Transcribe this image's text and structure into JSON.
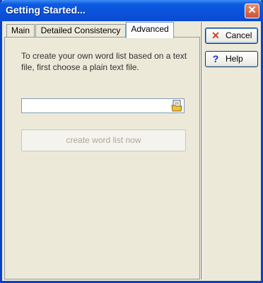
{
  "window": {
    "title": "Getting Started..."
  },
  "tabs": [
    {
      "label": "Main"
    },
    {
      "label": "Detailed Consistency"
    },
    {
      "label": "Advanced"
    }
  ],
  "advanced": {
    "instructions": "To create your own word list based on a text file, first choose a plain text file.",
    "file_path": "",
    "create_button": "create word list now"
  },
  "buttons": {
    "cancel": "Cancel",
    "help": "Help"
  },
  "colors": {
    "title_bar": "#0a52dc",
    "close_button": "#d05030",
    "disabled_text": "#aca899"
  },
  "icons": {
    "close": "close-icon",
    "cancel": "x-icon",
    "help": "question-mark-icon",
    "browse": "folder-icon"
  }
}
